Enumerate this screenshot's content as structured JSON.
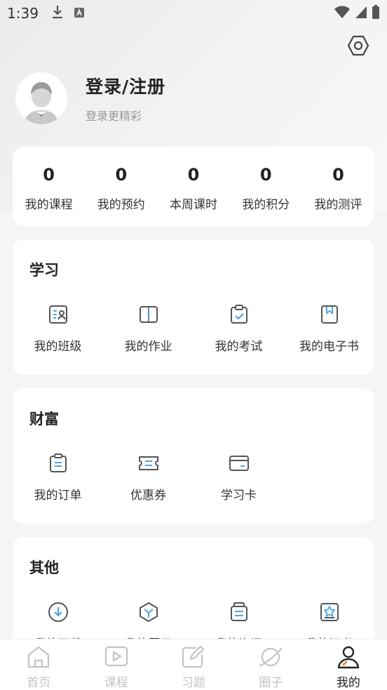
{
  "status_bar": {
    "time": "1:39"
  },
  "profile": {
    "title": "登录/注册",
    "subtitle": "登录更精彩"
  },
  "stats": [
    {
      "value": "0",
      "label": "我的课程"
    },
    {
      "value": "0",
      "label": "我的预约"
    },
    {
      "value": "0",
      "label": "本周课时"
    },
    {
      "value": "0",
      "label": "我的积分"
    },
    {
      "value": "0",
      "label": "我的测评"
    }
  ],
  "learning": {
    "title": "学习",
    "items": [
      {
        "label": "我的班级",
        "icon": "class-icon"
      },
      {
        "label": "我的作业",
        "icon": "homework-icon"
      },
      {
        "label": "我的考试",
        "icon": "exam-icon"
      },
      {
        "label": "我的电子书",
        "icon": "ebook-icon"
      }
    ]
  },
  "wealth": {
    "title": "财富",
    "items": [
      {
        "label": "我的订单",
        "icon": "order-icon"
      },
      {
        "label": "优惠券",
        "icon": "coupon-icon"
      },
      {
        "label": "学习卡",
        "icon": "study-card-icon"
      }
    ]
  },
  "other": {
    "title": "其他",
    "items": [
      {
        "label": "我的下载",
        "icon": "download-icon"
      },
      {
        "label": "我的圈子",
        "icon": "circle-icon"
      },
      {
        "label": "我的资讯",
        "icon": "news-icon"
      },
      {
        "label": "我的证书",
        "icon": "certificate-icon"
      }
    ]
  },
  "tabbar": {
    "tabs": [
      {
        "label": "首页",
        "icon": "home-icon"
      },
      {
        "label": "课程",
        "icon": "course-icon"
      },
      {
        "label": "习题",
        "icon": "exercise-icon"
      },
      {
        "label": "圈子",
        "icon": "planet-icon"
      },
      {
        "label": "我的",
        "icon": "profile-icon"
      }
    ],
    "active_index": 4
  },
  "colors": {
    "icon_dark": "#555555",
    "icon_accent": "#4aa8e0",
    "tab_active_accent": "#f07a2b",
    "tab_inactive": "#c4c4c4"
  }
}
